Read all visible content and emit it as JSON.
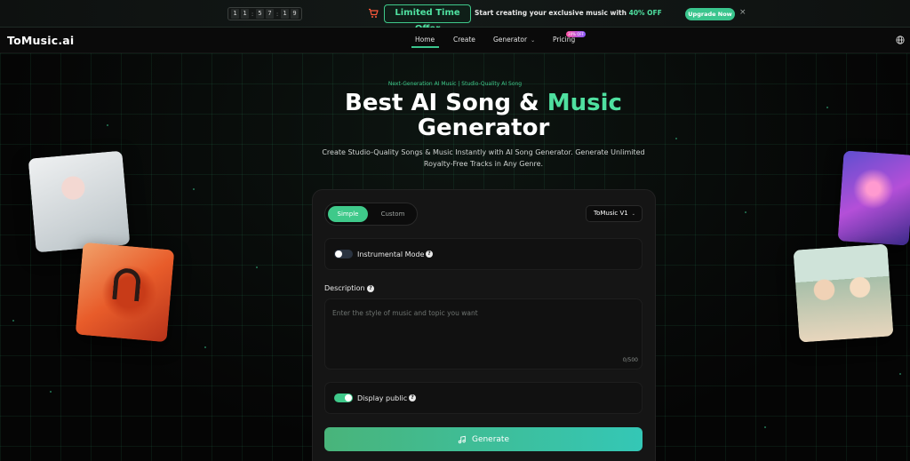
{
  "promo": {
    "countdown": [
      "1",
      "1",
      ":",
      "5",
      "7",
      ":",
      "1",
      "9"
    ],
    "offer_badge": "Limited Time Offer",
    "offer_text": "Start creating your exclusive music with",
    "offer_highlight": "40% OFF",
    "upgrade_label": "Upgrade Now",
    "close_glyph": "×",
    "cart_icon": "shopping-cart-icon"
  },
  "nav": {
    "logo": "ToMusic.ai",
    "home": "Home",
    "create": "Create",
    "generator": "Generator",
    "pricing": "Pricing",
    "pricing_badge": "30% OFF",
    "chevron": "⌄",
    "globe_icon": "globe-icon"
  },
  "hero": {
    "eyebrow": "Next-Generation AI Music | Studio-Quality AI Song",
    "title_part1": "Best AI Song & ",
    "title_highlight": "Music",
    "title_line2": "Generator",
    "subtitle_line1": "Create Studio-Quality Songs & Music Instantly with AI Song Generator. Generate Unlimited",
    "subtitle_line2": "Royalty-Free Tracks in Any Genre."
  },
  "generator": {
    "mode_simple": "Simple",
    "mode_custom": "Custom",
    "model": "ToMusic V1",
    "instrumental_label": "Instrumental Mode",
    "description_label": "Description",
    "description_placeholder": "Enter the style of music and topic you want",
    "char_count": "0/500",
    "public_label": "Display public",
    "generate_label": "Generate",
    "help_glyph": "?"
  },
  "colors": {
    "accent": "#3fc98a",
    "accent_text": "#4fe0a0",
    "background": "#050505",
    "panel": "#151515"
  }
}
